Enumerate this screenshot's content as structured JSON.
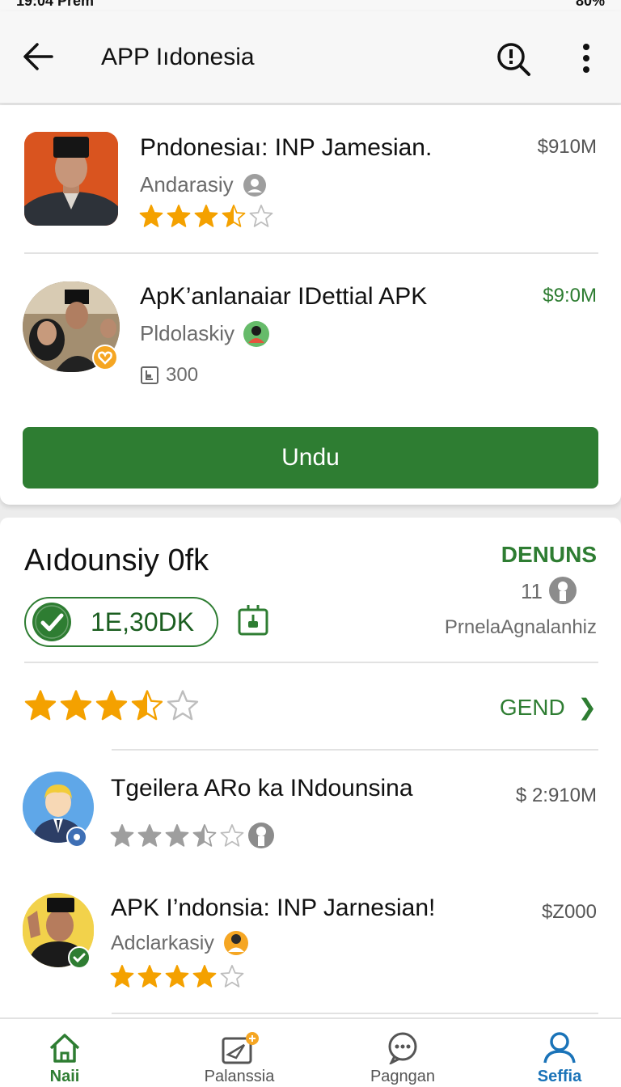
{
  "status": {
    "time": "19:04 Prem",
    "battery": "80%"
  },
  "appbar": {
    "title": "APP Iıdonesia"
  },
  "apps": [
    {
      "title": "Pndonesiaı: INP Jamesian.",
      "developer": "Andarasiy",
      "price": "$910M",
      "rating": 3.5
    },
    {
      "title": "ApK’anlanaiar IDettial APK",
      "developer": "Pldolaskiy",
      "price": "$9:0M",
      "downloads": "300"
    }
  ],
  "download_button": "Undu",
  "section": {
    "title": "Aıdounsiy 0fk",
    "pill_value": "1E,30DK",
    "link": "DENUNS",
    "count": "11",
    "subtitle": "PrnelaAgnalanhiz",
    "rating": 3.5,
    "more_link": "GEND"
  },
  "list": [
    {
      "title": "Tgeilera ARo ka INdounsina",
      "price": "$ 2:910M",
      "rating": 3.5
    },
    {
      "title": "APK I’ndonsia: INP Jarnesian!",
      "developer": "Adclarkasiy",
      "price": "$Z000",
      "rating": 4
    }
  ],
  "nav": [
    {
      "label": "Naii",
      "icon": "home-icon",
      "active": true
    },
    {
      "label": "Palanssia",
      "icon": "send-icon",
      "active": false
    },
    {
      "label": "Pagngan",
      "icon": "chat-icon",
      "active": false
    },
    {
      "label": "Seffia",
      "icon": "person-icon",
      "active": true
    }
  ],
  "colors": {
    "accent": "#2e7d32",
    "star": "#f4a100",
    "nav_active_blue": "#1a73b8"
  }
}
